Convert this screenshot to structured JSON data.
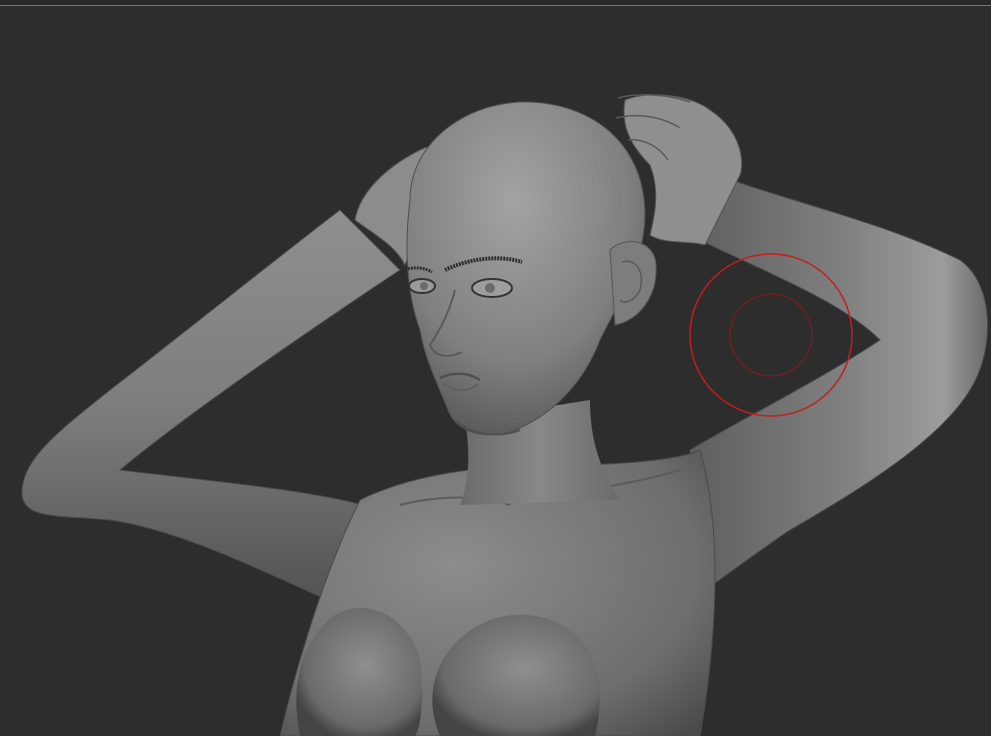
{
  "app": {
    "background_color": "#2d2d2d",
    "divider_color": "#777777"
  },
  "canvas": {
    "model": "female-bust-sculpt",
    "model_color": "#8a8a8a"
  },
  "brush": {
    "cursor_color": "#c41e1e",
    "icon": "brush-cursor-icon"
  }
}
